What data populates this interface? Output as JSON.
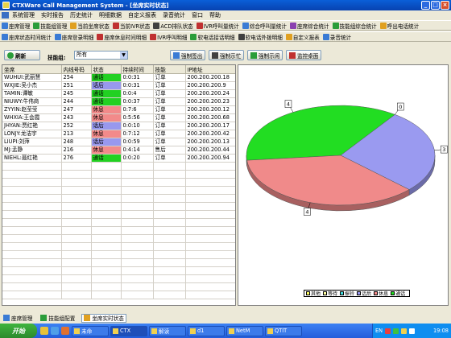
{
  "window": {
    "title": "CTXWare Call Management System - [坐席实时状态]",
    "controls": [
      "_",
      "□",
      "×"
    ]
  },
  "menu": [
    "系统管理",
    "实时报告",
    "历史统计",
    "明细数据",
    "自定义报表",
    "录音统计",
    "窗口",
    "帮助"
  ],
  "toolbar1": [
    {
      "label": "座席管理",
      "icon": "agent-icon",
      "color": "#3a7bd5"
    },
    {
      "label": "技能组管理",
      "icon": "skill-group-icon",
      "color": "#2a9d3a"
    },
    {
      "label": "当前坐席状态",
      "icon": "status-icon",
      "color": "#e0a020"
    },
    {
      "label": "当前IVR状态",
      "icon": "ivr-icon",
      "color": "#c03030"
    },
    {
      "label": "ACD排队状态",
      "icon": "queue-icon",
      "color": "#404040"
    },
    {
      "label": "IVR呼叫量统计",
      "icon": "ivr-stats-icon",
      "color": "#c03030"
    },
    {
      "label": "综合呼叫量统计",
      "icon": "call-stats-icon",
      "color": "#3a7bd5"
    },
    {
      "label": "座席综合统计",
      "icon": "agent-stats-icon",
      "color": "#8a40b0"
    },
    {
      "label": "技能组综合统计",
      "icon": "group-stats-icon",
      "color": "#2a9d3a"
    },
    {
      "label": "呼出电话统计",
      "icon": "outbound-icon",
      "color": "#e0a020"
    }
  ],
  "toolbar2": [
    {
      "label": "座席状态时间统计",
      "icon": "time-stats-icon",
      "color": "#3a7bd5"
    },
    {
      "label": "座席登录明细",
      "icon": "login-detail-icon",
      "color": "#3a7bd5"
    },
    {
      "label": "座席休息时间明细",
      "icon": "rest-detail-icon",
      "color": "#c03030"
    },
    {
      "label": "IVR呼叫明细",
      "icon": "ivr-detail-icon",
      "color": "#c03030"
    },
    {
      "label": "软电话接话明细",
      "icon": "softphone-in-icon",
      "color": "#2a9d3a"
    },
    {
      "label": "软电话外拨明细",
      "icon": "softphone-out-icon",
      "color": "#404040"
    },
    {
      "label": "自定义报表",
      "icon": "custom-report-icon",
      "color": "#e0a020"
    },
    {
      "label": "录音统计",
      "icon": "recording-icon",
      "color": "#3a7bd5"
    }
  ],
  "controls": {
    "refresh": "刷新",
    "filter_label": "技能组:",
    "filter_value": "所有",
    "force_signout": "强制签出",
    "force_busy": "强制示忙",
    "force_idle": "强制示闲",
    "monitor": "监控桌面"
  },
  "table": {
    "columns": [
      "坐席",
      "内线号码",
      "状态",
      "持续时间",
      "技能",
      "IP地址"
    ],
    "rows": [
      [
        "WUHUI:武丽慧",
        "254",
        "通话",
        "0:0:31",
        "订单",
        "200.200.200.18"
      ],
      [
        "WXJIE:吴小杰",
        "251",
        "话后",
        "0:0:31",
        "订单",
        "200.200.200.9"
      ],
      [
        "TAMIN:谭敏",
        "245",
        "通话",
        "0:0:4",
        "订单",
        "200.200.200.24"
      ],
      [
        "NIUWY:牛伟商",
        "244",
        "通话",
        "0:0:37",
        "订单",
        "200.200.200.23"
      ],
      [
        "ZYYIN:赵莹莹",
        "247",
        "休息",
        "0:7:6",
        "订单",
        "200.200.200.12"
      ],
      [
        "WHXIA:王会霞",
        "243",
        "休息",
        "0:5:56",
        "订单",
        "200.200.200.68"
      ],
      [
        "JHYAN:贾红艳",
        "252",
        "话后",
        "0:0:10",
        "订单",
        "200.200.200.17"
      ],
      [
        "LONJY:龙洁宇",
        "213",
        "休息",
        "0:7:12",
        "订单",
        "200.200.200.42"
      ],
      [
        "LIUPI:刘萍",
        "248",
        "话后",
        "0:0:59",
        "订单",
        "200.200.200.13"
      ],
      [
        "MJ:孟静",
        "216",
        "休息",
        "0:4:14",
        "售后",
        "200.200.200.44"
      ],
      [
        "NIEHL:聂红艳",
        "276",
        "通话",
        "0:0:20",
        "订单",
        "200.200.200.94"
      ]
    ]
  },
  "chart_data": {
    "type": "pie",
    "slices": [
      {
        "name": "通话",
        "value": 4,
        "color": "#22dd22"
      },
      {
        "name": "其他",
        "value": 0,
        "color": "#ffff60"
      },
      {
        "name": "话后",
        "value": 3,
        "color": "#9a9af0"
      },
      {
        "name": "休息",
        "value": 4,
        "color": "#f08a8a"
      }
    ],
    "legend": [
      {
        "name": "其他",
        "color": "#ffff60"
      },
      {
        "name": "等待",
        "color": "#ffffa0"
      },
      {
        "name": "振铃",
        "color": "#40e0e0"
      },
      {
        "name": "话后",
        "color": "#9a9af0"
      },
      {
        "name": "休息",
        "color": "#f08a8a"
      },
      {
        "name": "通话",
        "color": "#22dd22"
      }
    ],
    "legend_position": "bottom"
  },
  "bottom_tabs": [
    {
      "label": "座席管理",
      "icon": "agent-icon",
      "active": false
    },
    {
      "label": "技能组配置",
      "icon": "skill-group-icon",
      "active": false
    },
    {
      "label": "坐席实时状态",
      "icon": "status-icon",
      "active": true
    }
  ],
  "taskbar": {
    "start": "开始",
    "tasks": [
      "未命",
      "CTX",
      "解读",
      "d1",
      "NetM",
      "QTIT"
    ],
    "tray_lang": "EN",
    "clock": "19:08"
  }
}
